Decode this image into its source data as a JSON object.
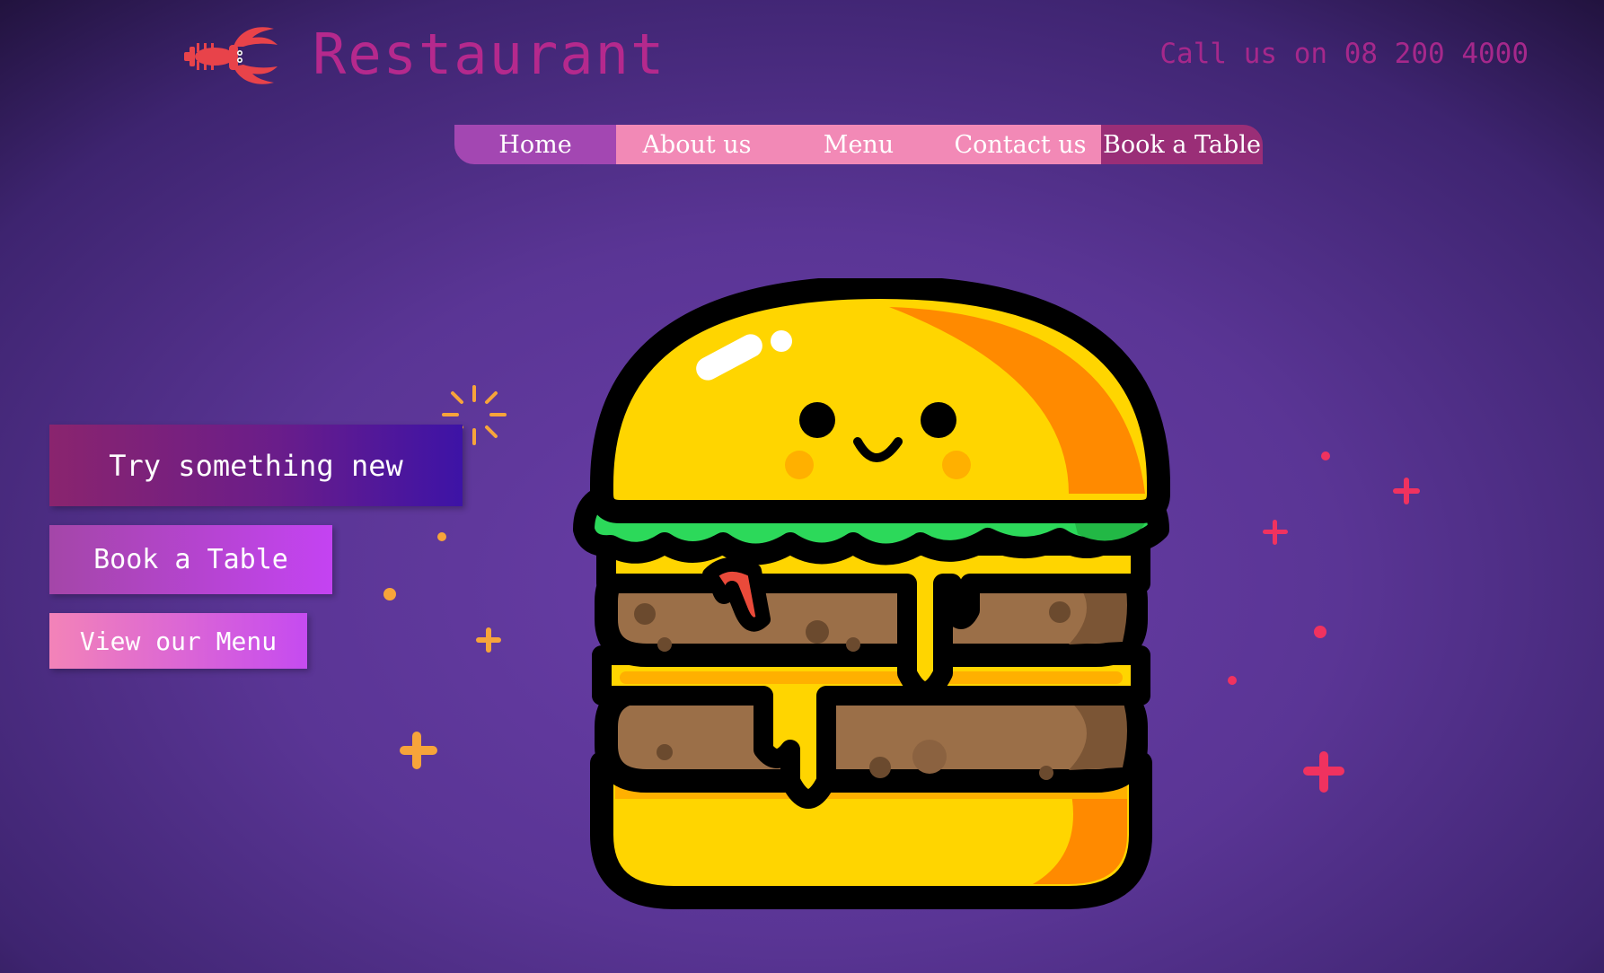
{
  "header": {
    "brand": "Restaurant",
    "phone": "Call us on 08 200 4000",
    "logo_icon": "lobster-icon"
  },
  "nav": {
    "items": [
      {
        "label": "Home",
        "active": true
      },
      {
        "label": "About us"
      },
      {
        "label": "Menu"
      },
      {
        "label": "Contact us"
      },
      {
        "label": "Book a Table"
      }
    ]
  },
  "cta": {
    "primary": "Try something new",
    "book": "Book a Table",
    "menu": "View our Menu"
  },
  "hero": {
    "illustration": "burger-mascot-icon"
  },
  "colors": {
    "brand": "#b5298d",
    "nav_home": "#a347b2",
    "nav_default": "#f289b6",
    "nav_book": "#9a2e77",
    "background": "#5a3595"
  }
}
